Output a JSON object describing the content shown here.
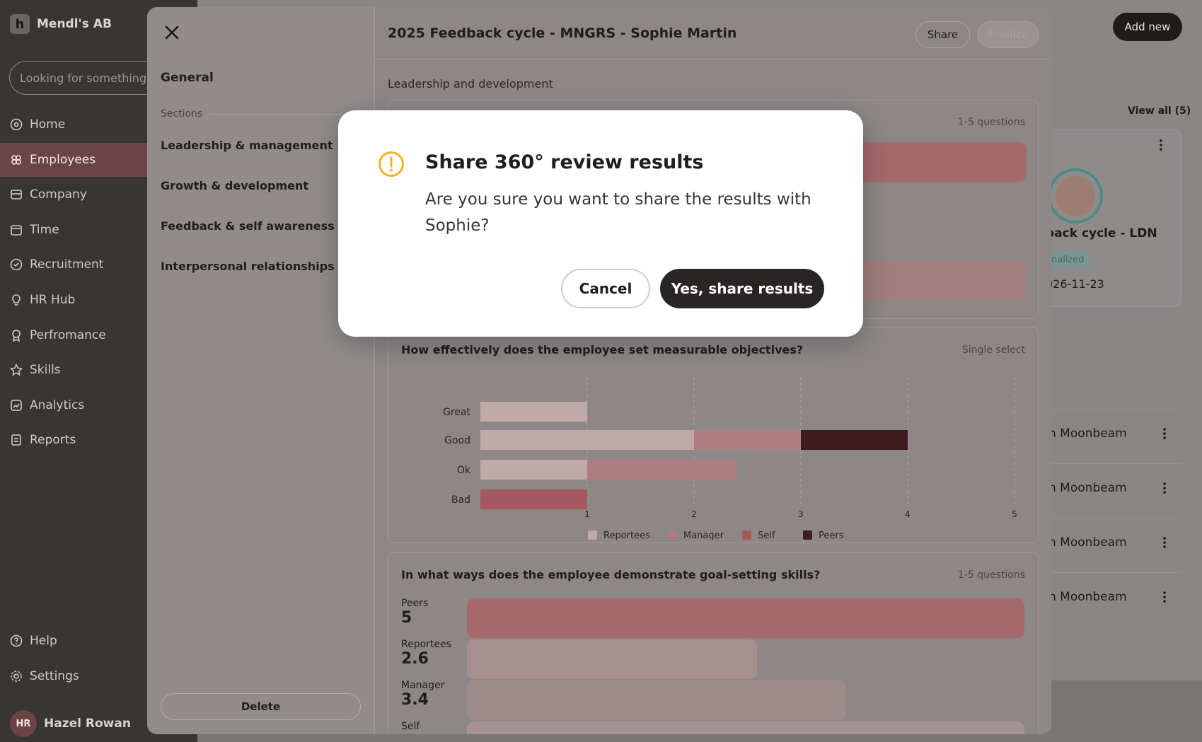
{
  "app": {
    "company": "Mendl's AB",
    "search_placeholder": "Looking for something",
    "nav": [
      {
        "label": "Home",
        "icon": "home-icon"
      },
      {
        "label": "Employees",
        "icon": "users-icon",
        "active": true
      },
      {
        "label": "Company",
        "icon": "building-icon"
      },
      {
        "label": "Time",
        "icon": "calendar-icon"
      },
      {
        "label": "Recruitment",
        "icon": "recruit-icon"
      },
      {
        "label": "HR Hub",
        "icon": "bulb-icon"
      },
      {
        "label": "Perfromance",
        "icon": "award-icon"
      },
      {
        "label": "Skills",
        "icon": "star-icon"
      },
      {
        "label": "Analytics",
        "icon": "analytics-icon"
      },
      {
        "label": "Reports",
        "icon": "reports-icon"
      }
    ],
    "nav_bottom": [
      {
        "label": "Help",
        "icon": "help-icon"
      },
      {
        "label": "Settings",
        "icon": "gear-icon"
      }
    ],
    "user": {
      "initials": "HR",
      "name": "Hazel Rowan"
    }
  },
  "background": {
    "add_new_label": "Add new",
    "view_all_label": "View all (5)",
    "cycle_title": "back cycle - LDN",
    "cycle_badge": "nalized",
    "cycle_date": "026-11-23",
    "rows": [
      "n Moonbeam",
      "n Moonbeam",
      "n Moonbeam",
      "n Moonbeam"
    ]
  },
  "panel": {
    "title": "2025 Feedback cycle - MNGRS - Sophie Martin",
    "share_label": "Share",
    "finalize_label": "Finalize",
    "general_label": "General",
    "sections_label": "Sections",
    "sections": [
      "Leadership & management",
      "Growth & development",
      "Feedback & self awareness",
      "Interpersonal relationships"
    ],
    "delete_label": "Delete",
    "subheading": "Leadership and development",
    "q1_meta": "1-5 questions",
    "q2_title": "How effectively does the employee set measurable objectives?",
    "q2_meta": "Single select",
    "q3_title": "In what ways does the employee demonstrate goal-setting skills?",
    "q3_meta": "1-5 questions",
    "q3_metrics": [
      {
        "label": "Peers",
        "value": "5"
      },
      {
        "label": "Reportees",
        "value": "2.6"
      },
      {
        "label": "Manager",
        "value": "3.4"
      },
      {
        "label": "Self",
        "value": ""
      }
    ]
  },
  "colors": {
    "reportees": "#c2a9a9",
    "manager": "#ad7d7f",
    "self": "#a5595e",
    "peers": "#3d1c1f"
  },
  "chart_data": {
    "type": "bar",
    "orientation": "horizontal-stacked",
    "categories": [
      "Great",
      "Good",
      "Ok",
      "Bad"
    ],
    "series": [
      {
        "name": "Reportees",
        "values": [
          1,
          2,
          1,
          0
        ]
      },
      {
        "name": "Manager",
        "values": [
          0,
          1,
          1.4,
          0
        ]
      },
      {
        "name": "Self",
        "values": [
          0,
          0,
          0,
          1
        ]
      },
      {
        "name": "Peers",
        "values": [
          0,
          1,
          0,
          0
        ]
      }
    ],
    "xticks": [
      "1",
      "2",
      "3",
      "4",
      "5"
    ],
    "xlim": [
      0,
      5
    ],
    "grid": "vertical-dashed",
    "legend": "bottom"
  },
  "modal": {
    "title": "Share 360° review results",
    "body": "Are you sure you want to share the results with Sophie?",
    "cancel_label": "Cancel",
    "confirm_label": "Yes, share results"
  }
}
